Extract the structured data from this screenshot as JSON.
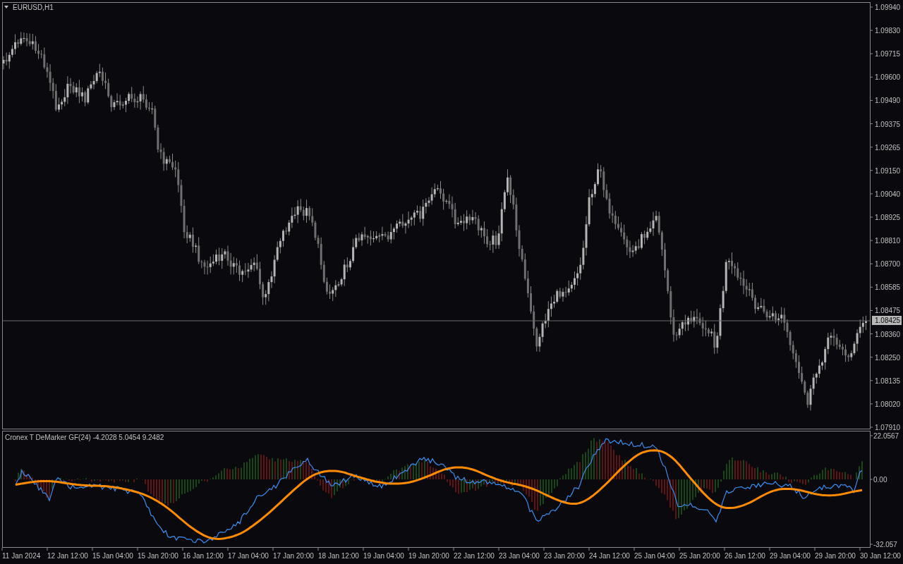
{
  "chart": {
    "title": "EURUSD,H1",
    "price_axis": [
      "1.09940",
      "1.09830",
      "1.09715",
      "1.09600",
      "1.09490",
      "1.09375",
      "1.09265",
      "1.09150",
      "1.09040",
      "1.08925",
      "1.08810",
      "1.08700",
      "1.08585",
      "1.08475",
      "1.08360",
      "1.08250",
      "1.08135",
      "1.08020",
      "1.07910"
    ],
    "current_price": "1.08425"
  },
  "indicator": {
    "title": "Cronex T DeMarker GF(24) -4.2028 5.0454 9.2482",
    "axis": [
      "22.0567",
      "0.00",
      "-32.057"
    ]
  },
  "time_axis": [
    "11 Jan 2024",
    "12 Jan 12:00",
    "15 Jan 04:00",
    "15 Jan 20:00",
    "16 Jan 12:00",
    "17 Jan 04:00",
    "17 Jan 20:00",
    "18 Jan 12:00",
    "19 Jan 04:00",
    "19 Jan 20:00",
    "22 Jan 12:00",
    "23 Jan 04:00",
    "23 Jan 20:00",
    "24 Jan 12:00",
    "25 Jan 04:00",
    "25 Jan 20:00",
    "26 Jan 12:00",
    "29 Jan 04:00",
    "29 Jan 20:00",
    "30 Jan 12:00"
  ]
}
